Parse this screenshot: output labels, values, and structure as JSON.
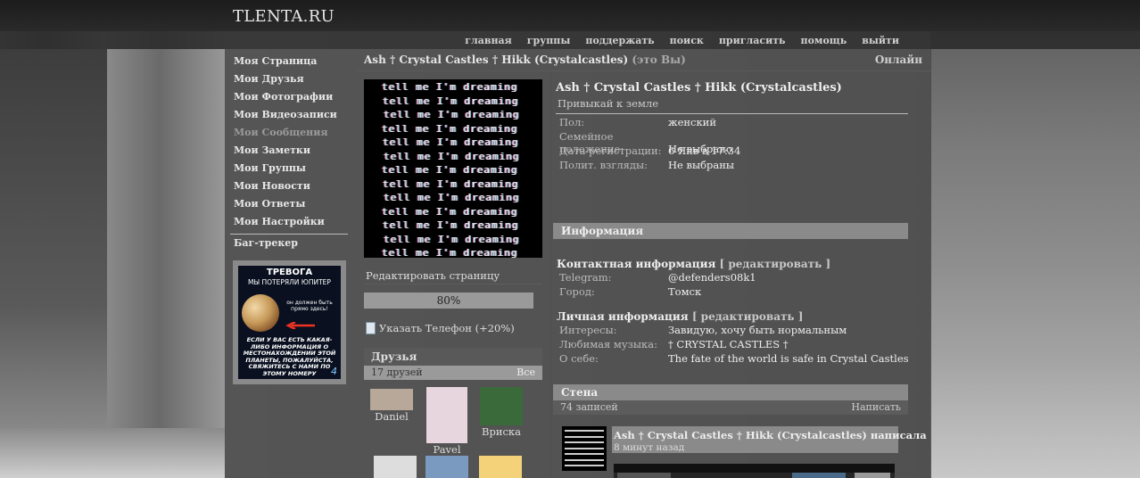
{
  "site": {
    "logo": "TLENTA.RU"
  },
  "nav": [
    "главная",
    "группы",
    "поддержать",
    "поиск",
    "пригласить",
    "помощь",
    "выйти"
  ],
  "sidebar": {
    "items": [
      {
        "label": "Моя Страница",
        "active": false
      },
      {
        "label": "Мои Друзья",
        "active": false
      },
      {
        "label": "Мои Фотографии",
        "active": false
      },
      {
        "label": "Мои Видеозаписи",
        "active": false
      },
      {
        "label": "Мои Сообщения",
        "active": true
      },
      {
        "label": "Мои Заметки",
        "active": false
      },
      {
        "label": "Мои Группы",
        "active": false
      },
      {
        "label": "Мои Новости",
        "active": false
      },
      {
        "label": "Мои Ответы",
        "active": false
      },
      {
        "label": "Мои Настройки",
        "active": false
      }
    ],
    "bug_tracker": "Баг-трекер",
    "ad": {
      "title": "ТРЕВОГА",
      "subtitle": "МЫ ПОТЕРЯЛИ ЮПИТЕР",
      "note": "он должен быть прямо здесь!",
      "bottom": "ЕСЛИ У ВАС ЕСТЬ КАКАЯ-ЛИБО ИНФОРМАЦИЯ О МЕСТОНАХОЖДЕНИИ ЭТОЙ ПЛАНЕТЫ, ПОЖАЛУЙСТА, СВЯЖИТЕСЬ С НАМИ ПО ЭТОМУ НОМЕРУ",
      "number": "4"
    }
  },
  "header": {
    "user_link": "Ash † Crystal Castles † Hikk (Crystalcastles)",
    "self_note": "(это Вы)",
    "online": "Онлайн"
  },
  "avatar": {
    "lines": [
      "tell me I'm dreaming",
      "tell me I'm dreaming",
      "tell me I'm dreaming",
      "tell me I'm dreaming",
      "tell me I'm dreaming",
      "tell me I'm dreaming",
      "tell me I'm dreaming",
      "tell me I'm dreaming",
      "tell me I'm dreaming",
      "tell me I'm dreaming",
      "tell me I'm dreaming",
      "tell me I'm dreaming",
      "tell me I'm dreaming"
    ]
  },
  "left_column": {
    "edit_page": "Редактировать страницу",
    "progress_label": "80%",
    "progress_value": 0.8,
    "phone_link": "Указать Телефон (+20%)",
    "friends_title": "Друзья",
    "friends_count": "17 друзей",
    "friends_all": "Все",
    "friends": [
      {
        "name": "Daniel",
        "color": "#b8a89a"
      },
      {
        "name": "Pavel",
        "color": "#e8d6de"
      },
      {
        "name": "Вриска",
        "color": "#3a6a3a"
      }
    ]
  },
  "profile": {
    "name": "Ash † Crystal Castles † Hikk (Crystalcastles)",
    "status": "Привыкай к земле",
    "basic": [
      {
        "key": "Пол:",
        "value": "женский"
      },
      {
        "key": "Семейное положение:",
        "value": "Не выбрано"
      },
      {
        "key": "Дата регистрации:",
        "value": "6 Янв в 17:34"
      },
      {
        "key": "Полит. взгляды:",
        "value": "Не выбраны"
      }
    ],
    "info_title": "Информация",
    "contact_title": "Контактная информация",
    "contact_edit": "[ редактировать ]",
    "contact": [
      {
        "key": "Telegram:",
        "value": "@defenders08k1"
      },
      {
        "key": "Город:",
        "value": "Томск"
      }
    ],
    "personal_title": "Личная информация",
    "personal_edit": "[ редактировать ]",
    "personal": [
      {
        "key": "Интересы:",
        "value": "Завидую, хочу быть нормальным"
      },
      {
        "key": "Любимая музыка:",
        "value": "† CRYSTAL CASTLES †"
      },
      {
        "key": "О себе:",
        "value": "The fate of the world is safe in Crystal Castles"
      }
    ]
  },
  "wall": {
    "title": "Стена",
    "count": "74 записей",
    "write": "Написать",
    "post": {
      "author": "Ash † Crystal Castles † Hikk (Crystalcastles) написала",
      "time": "8 минут назад"
    }
  }
}
